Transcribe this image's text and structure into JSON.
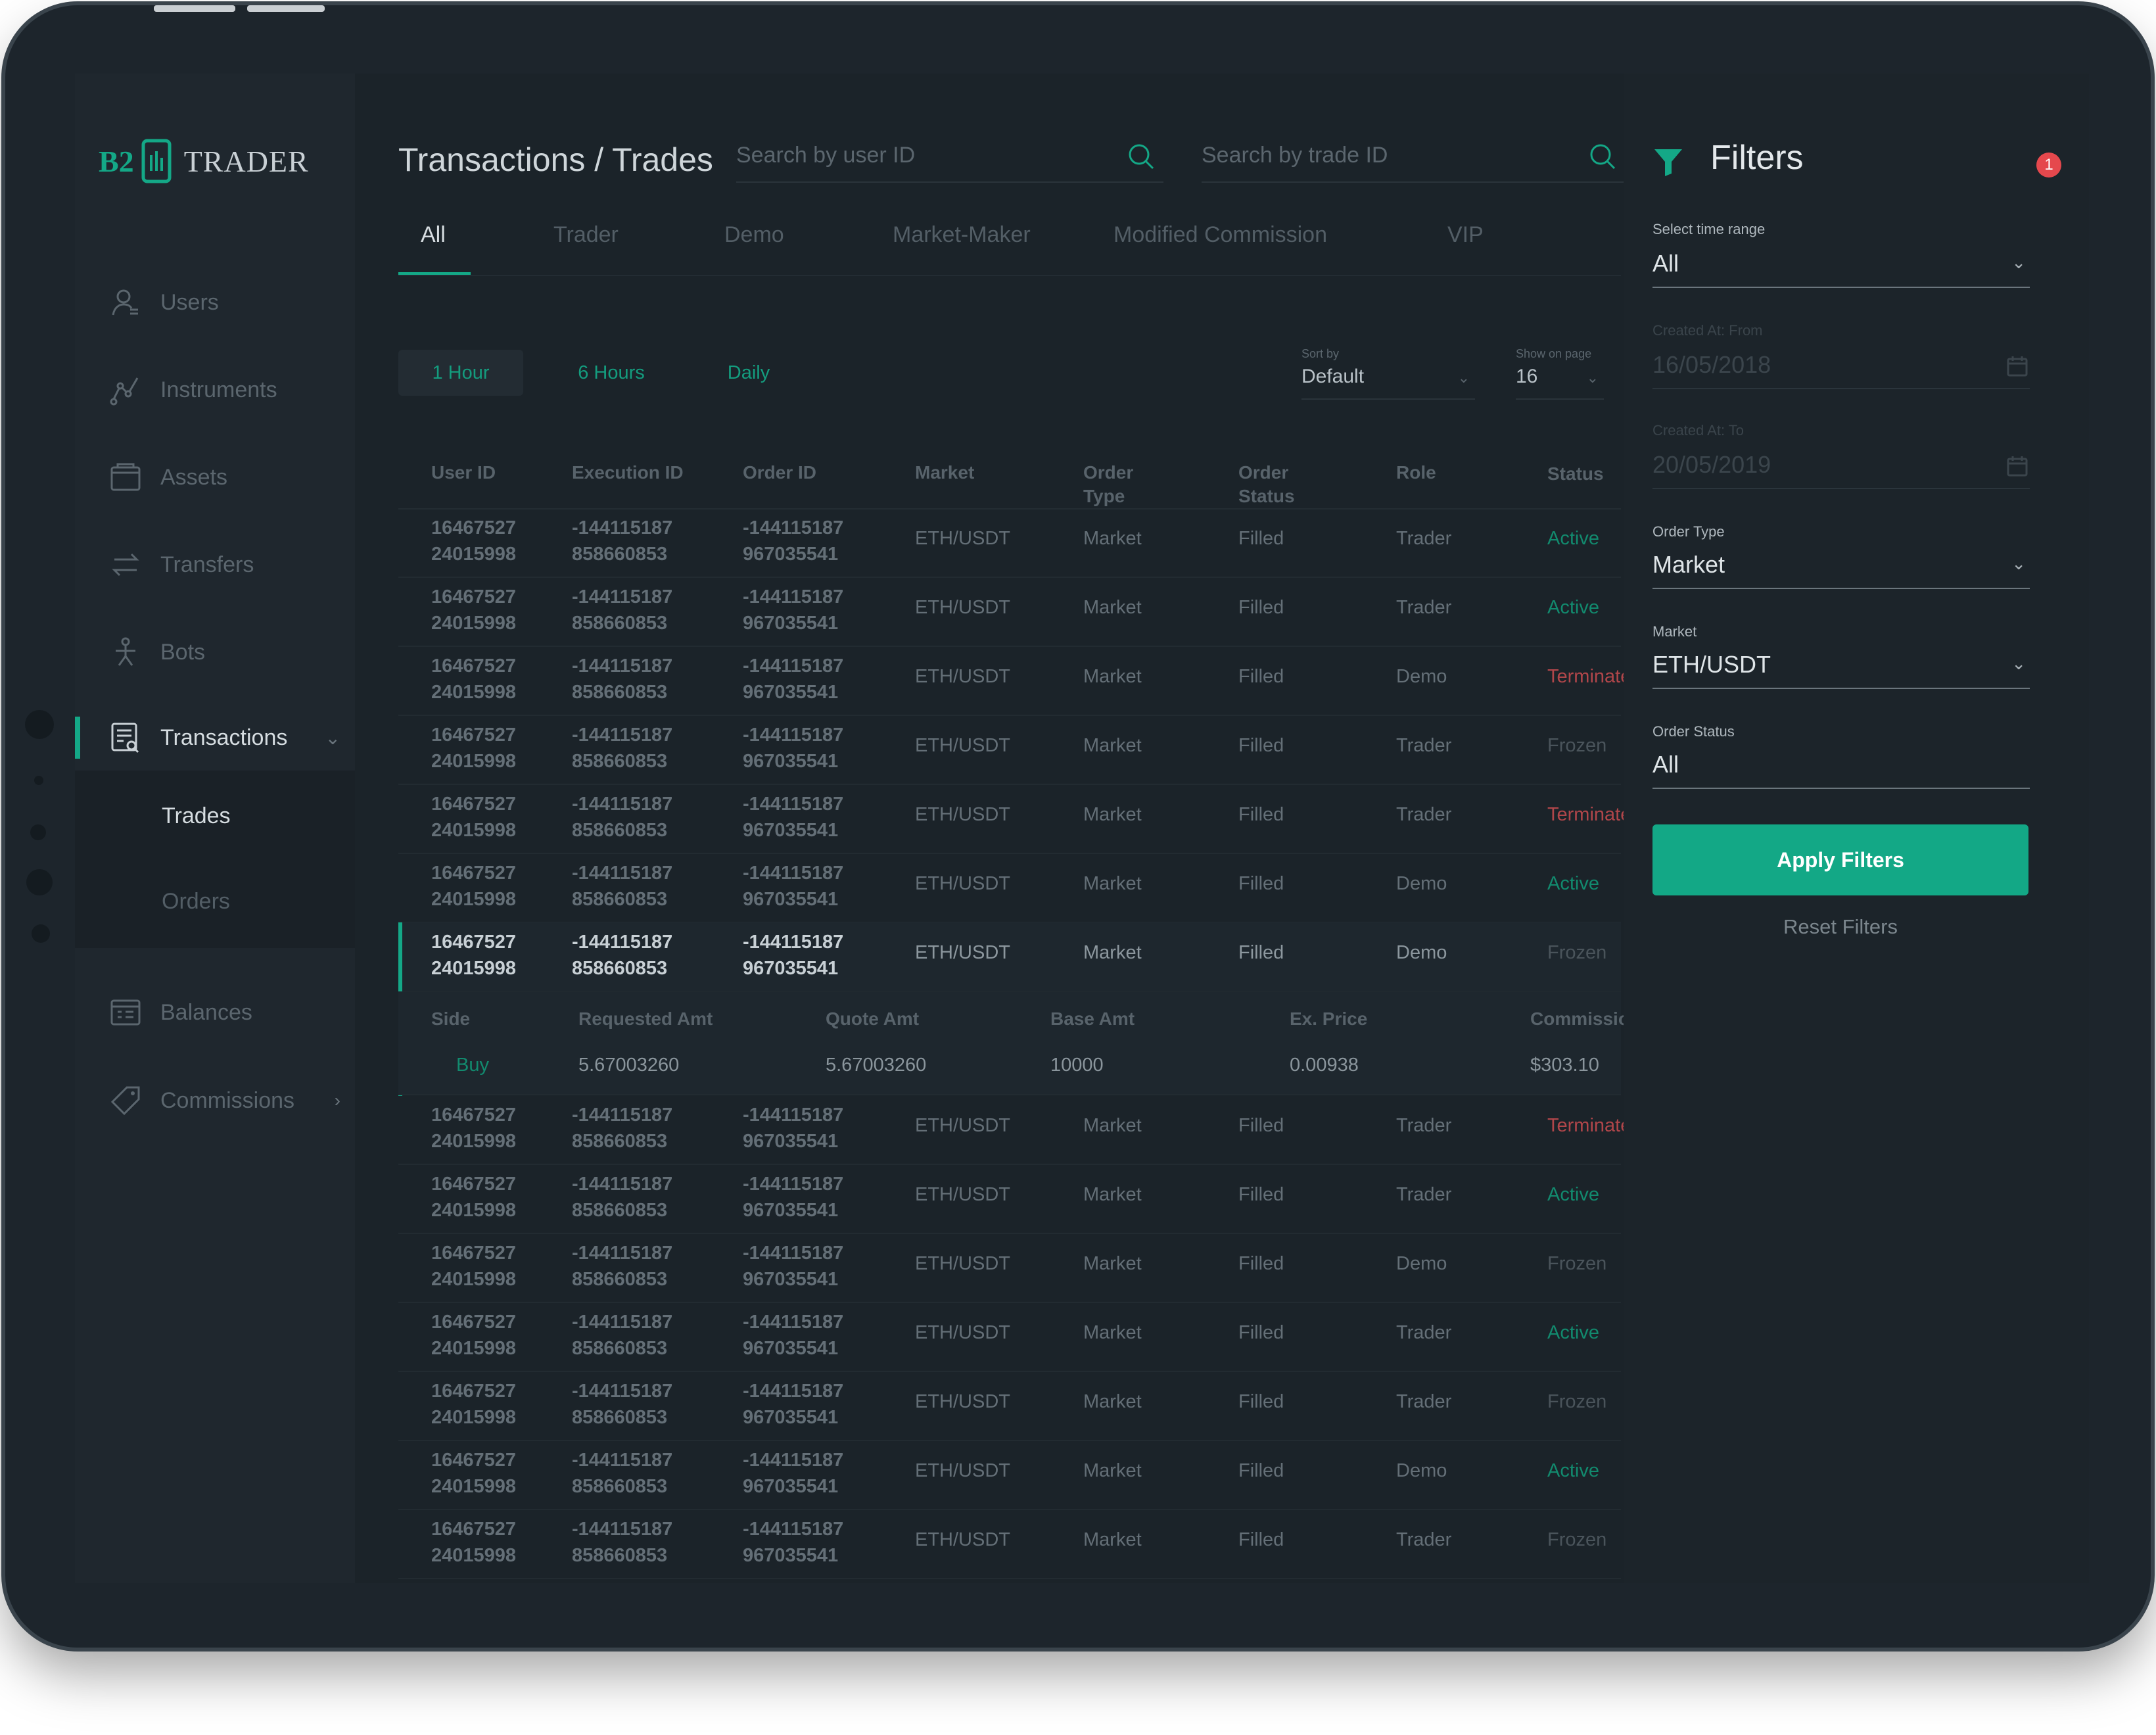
{
  "brand": {
    "logo_left": "B2",
    "logo_right": "TRADER"
  },
  "sidebar": {
    "items": [
      {
        "label": "Users",
        "icon": "users-icon"
      },
      {
        "label": "Instruments",
        "icon": "instruments-icon"
      },
      {
        "label": "Assets",
        "icon": "assets-icon"
      },
      {
        "label": "Transfers",
        "icon": "transfers-icon"
      },
      {
        "label": "Bots",
        "icon": "bots-icon"
      },
      {
        "label": "Transactions",
        "icon": "transactions-icon"
      },
      {
        "label": "Balances",
        "icon": "balances-icon"
      },
      {
        "label": "Commissions",
        "icon": "commissions-icon"
      }
    ],
    "sub_items": [
      "Trades",
      "Orders"
    ]
  },
  "header": {
    "title": "Transactions / Trades",
    "search_user_placeholder": "Search by user ID",
    "search_trade_placeholder": "Search by trade ID"
  },
  "tabs": [
    "All",
    "Trader",
    "Demo",
    "Market-Maker",
    "Modified Commission",
    "VIP"
  ],
  "ranges": [
    "1 Hour",
    "6 Hours",
    "Daily"
  ],
  "sort": {
    "label": "Sort by",
    "value": "Default"
  },
  "page_size": {
    "label": "Show on page",
    "value": "16"
  },
  "table": {
    "columns": [
      "User ID",
      "Execution ID",
      "Order ID",
      "Market",
      "Order\nType",
      "Order\nStatus",
      "Role",
      "Status"
    ],
    "rows": [
      {
        "user_id": [
          "16467527",
          "24015998"
        ],
        "exec_id": [
          "-144115187",
          "858660853"
        ],
        "order_id": [
          "-144115187",
          "967035541"
        ],
        "market": "ETH/USDT",
        "order_type": "Market",
        "order_status": "Filled",
        "role": "Trader",
        "status": "Active"
      },
      {
        "user_id": [
          "16467527",
          "24015998"
        ],
        "exec_id": [
          "-144115187",
          "858660853"
        ],
        "order_id": [
          "-144115187",
          "967035541"
        ],
        "market": "ETH/USDT",
        "order_type": "Market",
        "order_status": "Filled",
        "role": "Trader",
        "status": "Active"
      },
      {
        "user_id": [
          "16467527",
          "24015998"
        ],
        "exec_id": [
          "-144115187",
          "858660853"
        ],
        "order_id": [
          "-144115187",
          "967035541"
        ],
        "market": "ETH/USDT",
        "order_type": "Market",
        "order_status": "Filled",
        "role": "Demo",
        "status": "Terminated"
      },
      {
        "user_id": [
          "16467527",
          "24015998"
        ],
        "exec_id": [
          "-144115187",
          "858660853"
        ],
        "order_id": [
          "-144115187",
          "967035541"
        ],
        "market": "ETH/USDT",
        "order_type": "Market",
        "order_status": "Filled",
        "role": "Trader",
        "status": "Frozen"
      },
      {
        "user_id": [
          "16467527",
          "24015998"
        ],
        "exec_id": [
          "-144115187",
          "858660853"
        ],
        "order_id": [
          "-144115187",
          "967035541"
        ],
        "market": "ETH/USDT",
        "order_type": "Market",
        "order_status": "Filled",
        "role": "Trader",
        "status": "Terminated"
      },
      {
        "user_id": [
          "16467527",
          "24015998"
        ],
        "exec_id": [
          "-144115187",
          "858660853"
        ],
        "order_id": [
          "-144115187",
          "967035541"
        ],
        "market": "ETH/USDT",
        "order_type": "Market",
        "order_status": "Filled",
        "role": "Demo",
        "status": "Active"
      },
      {
        "user_id": [
          "16467527",
          "24015998"
        ],
        "exec_id": [
          "-144115187",
          "858660853"
        ],
        "order_id": [
          "-144115187",
          "967035541"
        ],
        "market": "ETH/USDT",
        "order_type": "Market",
        "order_status": "Filled",
        "role": "Demo",
        "status": "Frozen",
        "selected": true
      },
      {
        "user_id": [
          "16467527",
          "24015998"
        ],
        "exec_id": [
          "-144115187",
          "858660853"
        ],
        "order_id": [
          "-144115187",
          "967035541"
        ],
        "market": "ETH/USDT",
        "order_type": "Market",
        "order_status": "Filled",
        "role": "Trader",
        "status": "Terminated"
      },
      {
        "user_id": [
          "16467527",
          "24015998"
        ],
        "exec_id": [
          "-144115187",
          "858660853"
        ],
        "order_id": [
          "-144115187",
          "967035541"
        ],
        "market": "ETH/USDT",
        "order_type": "Market",
        "order_status": "Filled",
        "role": "Trader",
        "status": "Active"
      },
      {
        "user_id": [
          "16467527",
          "24015998"
        ],
        "exec_id": [
          "-144115187",
          "858660853"
        ],
        "order_id": [
          "-144115187",
          "967035541"
        ],
        "market": "ETH/USDT",
        "order_type": "Market",
        "order_status": "Filled",
        "role": "Demo",
        "status": "Frozen"
      },
      {
        "user_id": [
          "16467527",
          "24015998"
        ],
        "exec_id": [
          "-144115187",
          "858660853"
        ],
        "order_id": [
          "-144115187",
          "967035541"
        ],
        "market": "ETH/USDT",
        "order_type": "Market",
        "order_status": "Filled",
        "role": "Trader",
        "status": "Active"
      },
      {
        "user_id": [
          "16467527",
          "24015998"
        ],
        "exec_id": [
          "-144115187",
          "858660853"
        ],
        "order_id": [
          "-144115187",
          "967035541"
        ],
        "market": "ETH/USDT",
        "order_type": "Market",
        "order_status": "Filled",
        "role": "Trader",
        "status": "Frozen"
      },
      {
        "user_id": [
          "16467527",
          "24015998"
        ],
        "exec_id": [
          "-144115187",
          "858660853"
        ],
        "order_id": [
          "-144115187",
          "967035541"
        ],
        "market": "ETH/USDT",
        "order_type": "Market",
        "order_status": "Filled",
        "role": "Demo",
        "status": "Active"
      },
      {
        "user_id": [
          "16467527",
          "24015998"
        ],
        "exec_id": [
          "-144115187",
          "858660853"
        ],
        "order_id": [
          "-144115187",
          "967035541"
        ],
        "market": "ETH/USDT",
        "order_type": "Market",
        "order_status": "Filled",
        "role": "Trader",
        "status": "Frozen"
      }
    ],
    "detail": {
      "columns": [
        "Side",
        "Requested Amt",
        "Quote Amt",
        "Base Amt",
        "Ex. Price",
        "Commission (U"
      ],
      "values": [
        "Buy",
        "5.67003260",
        "5.67003260",
        "10000",
        "0.00938",
        "$303.10"
      ]
    }
  },
  "filters": {
    "title": "Filters",
    "badge": "1",
    "time_range": {
      "label": "Select time range",
      "value": "All"
    },
    "created_from": {
      "label": "Created At: From",
      "value": "16/05/2018"
    },
    "created_to": {
      "label": "Created At: To",
      "value": "20/05/2019"
    },
    "order_type": {
      "label": "Order Type",
      "value": "Market"
    },
    "market": {
      "label": "Market",
      "value": "ETH/USDT"
    },
    "order_status": {
      "label": "Order Status",
      "value": "All"
    },
    "apply_label": "Apply Filters",
    "reset_label": "Reset Filters"
  },
  "colors": {
    "accent": "#14a887",
    "active": "#128a6e",
    "terminated": "#b0464a",
    "frozen": "#4a545b",
    "badge": "#e5484d"
  }
}
